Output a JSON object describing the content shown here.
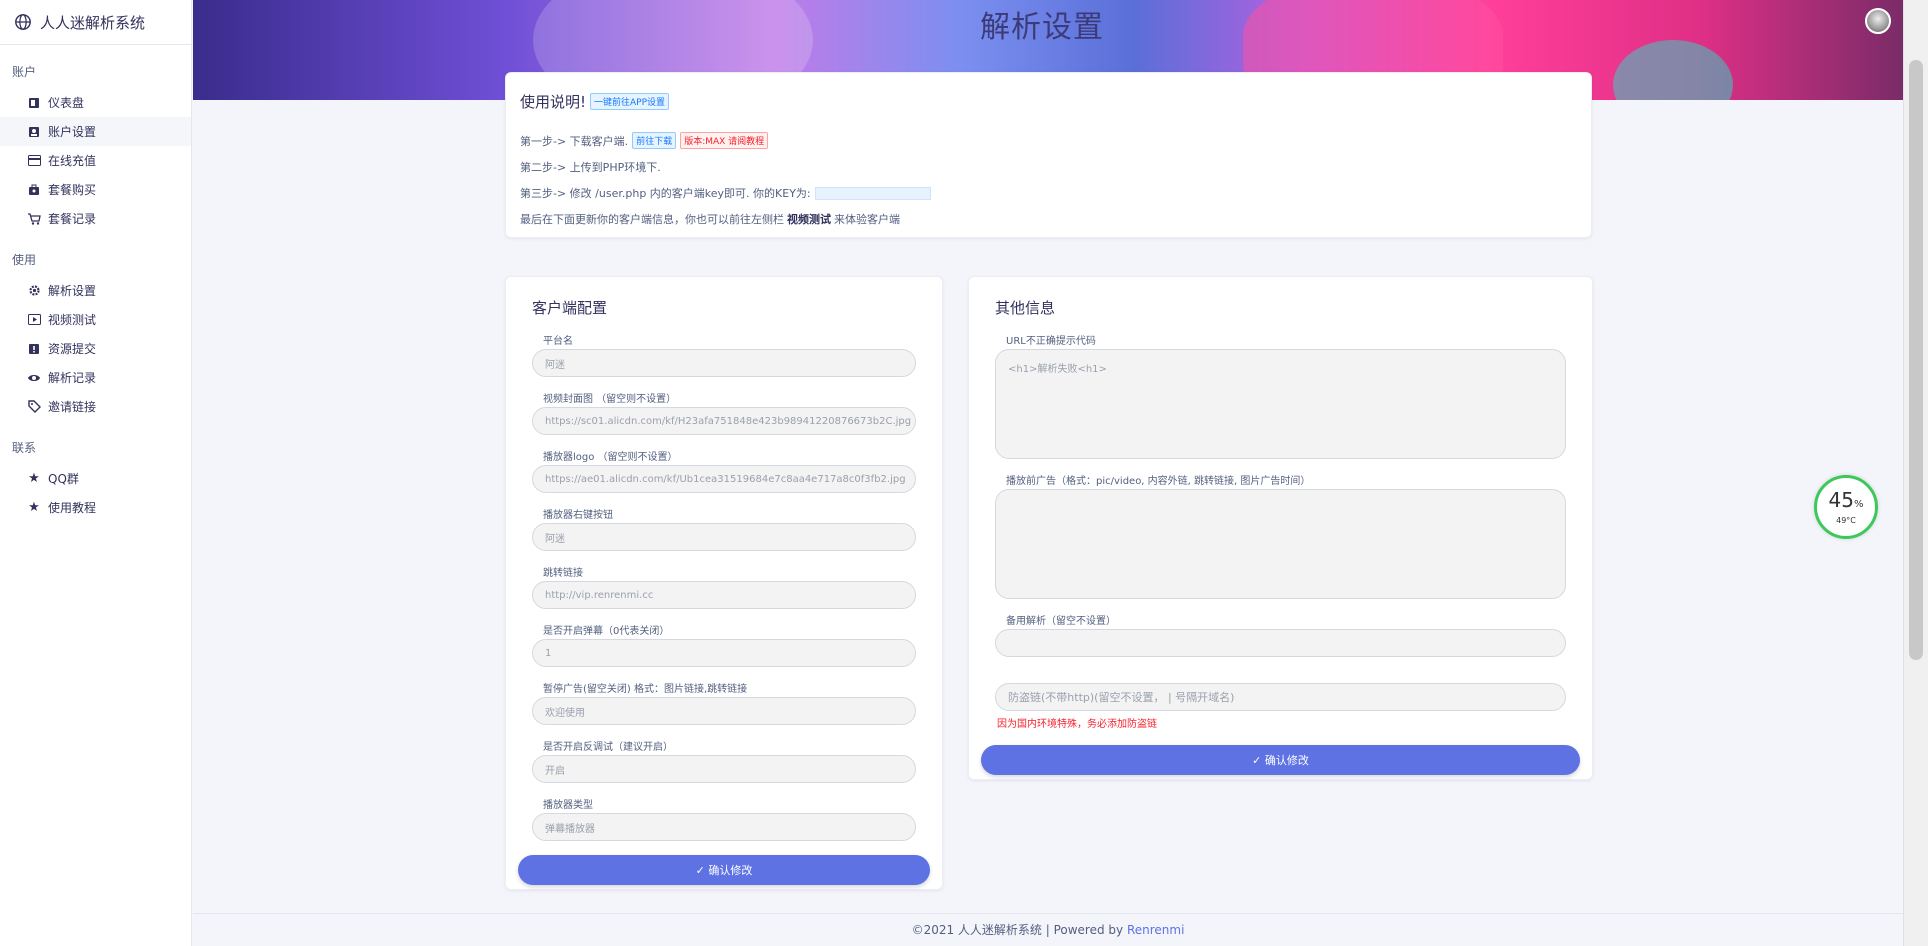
{
  "brand": {
    "title": "人人迷解析系统"
  },
  "sidebar": {
    "sections": [
      {
        "heading": "账户",
        "items": [
          {
            "label": "仪表盘",
            "icon": "dashboard-icon"
          },
          {
            "label": "账户设置",
            "icon": "user-icon"
          },
          {
            "label": "在线充值",
            "icon": "card-icon"
          },
          {
            "label": "套餐购买",
            "icon": "bag-icon"
          },
          {
            "label": "套餐记录",
            "icon": "cart-icon"
          }
        ]
      },
      {
        "heading": "使用",
        "items": [
          {
            "label": "解析设置",
            "icon": "gear-icon"
          },
          {
            "label": "视频测试",
            "icon": "video-icon"
          },
          {
            "label": "资源提交",
            "icon": "alert-icon"
          },
          {
            "label": "解析记录",
            "icon": "eye-icon"
          },
          {
            "label": "邀请链接",
            "icon": "tag-icon"
          }
        ]
      },
      {
        "heading": "联系",
        "items": [
          {
            "label": "QQ群",
            "icon": "star-icon"
          },
          {
            "label": "使用教程",
            "icon": "star-icon"
          }
        ]
      }
    ]
  },
  "hero": {
    "title": "解析设置"
  },
  "intro": {
    "title": "使用说明!",
    "title_tag": "一键前往APP设置",
    "step1": "第一步-> 下载客户端.",
    "step1_tag1": "前往下载",
    "step1_tag2": "版本:MAX 请阅教程",
    "step2": "第二步-> 上传到PHP环境下.",
    "step3": "第三步-> 修改 /user.php 内的客户端key即可. 你的KEY为:",
    "step4_pre": "最后在下面更新你的客户端信息，你也可以前往左侧栏",
    "step4_bold": "视频测试",
    "step4_post": "来体验客户端"
  },
  "config": {
    "title": "客户端配置",
    "fields": [
      {
        "label": "平台名",
        "value": "阿迷"
      },
      {
        "label": "视频封面图 （留空则不设置）",
        "value": "https://sc01.alicdn.com/kf/H23afa751848e423b98941220876673b2C.jpg"
      },
      {
        "label": "播放器logo （留空则不设置）",
        "value": "https://ae01.alicdn.com/kf/Ub1cea31519684e7c8aa4e717a8c0f3fb2.jpg"
      },
      {
        "label": "播放器右键按钮",
        "value": "阿迷"
      },
      {
        "label": "跳转链接",
        "value": "http://vip.renrenmi.cc"
      },
      {
        "label": "是否开启弹幕（0代表关闭）",
        "value": "1"
      },
      {
        "label": "暂停广告(留空关闭) 格式：图片链接,跳转链接",
        "value": "欢迎使用"
      },
      {
        "label": "是否开启反调试（建议开启）",
        "value": "开启"
      },
      {
        "label": "播放器类型",
        "value": "弹幕播放器"
      }
    ],
    "button": "✓ 确认修改"
  },
  "other": {
    "title": "其他信息",
    "url_error_label": "URL不正确提示代码",
    "url_error_value": "<h1>解析失败<h1>",
    "pre_ad_label": "播放前广告（格式：pic/video, 内容外链, 跳转链接, 图片广告时间）",
    "backup_label": "备用解析（留空不设置）",
    "antileech_placeholder": "防盗链(不带http)(留空不设置， | 号隔开域名)",
    "warning": "因为国内环境特殊，务必添加防盗链",
    "button": "✓ 确认修改"
  },
  "footer": {
    "text": "©2021 人人迷解析系统 | Powered by ",
    "link": "Renrenmi"
  },
  "gauge": {
    "percent": "45",
    "unit": "%",
    "temp": "49°C"
  },
  "colors": {
    "accent": "#5e72e4",
    "warning": "#f5222d"
  }
}
